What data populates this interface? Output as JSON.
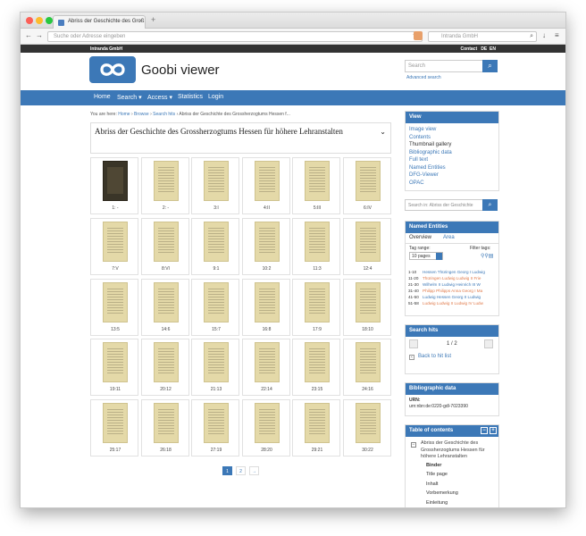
{
  "browser": {
    "tab_title": "Abriss der Geschichte des Groß",
    "tab_close": "×",
    "new_tab": "+",
    "address_placeholder": "Suche oder Adresse eingeben",
    "search_placeholder": "Intranda GmbH"
  },
  "topstrip": {
    "brand": "Intranda GmbH",
    "contact": "Contact",
    "lang_de": "DE",
    "lang_en": "EN"
  },
  "header": {
    "logo_text": "Goobi viewer",
    "search_placeholder": "Search",
    "advanced_search": "Advanced search"
  },
  "nav": {
    "home": "Home",
    "search": "Search ▾",
    "access": "Access ▾",
    "statistics": "Statistics",
    "login": "Login"
  },
  "breadcrumb": {
    "prefix": "You are here:",
    "home": "Home",
    "browse": "Browse",
    "hits": "Search hits",
    "current": "Abriss der Geschichte des Grossherzogtums Hessen f..."
  },
  "record": {
    "title": "Abriss der Geschichte des Grossherzogtums Hessen für höhere Lehranstalten"
  },
  "thumbnails": [
    "1: -",
    "2: -",
    "3:I",
    "4:II",
    "5:III",
    "6:IV",
    "7:V",
    "8:VI",
    "9:1",
    "10:2",
    "11:3",
    "12:4",
    "13:5",
    "14:6",
    "15:7",
    "16:8",
    "17:9",
    "18:10",
    "19:11",
    "20:12",
    "21:13",
    "22:14",
    "23:15",
    "24:16",
    "25:17",
    "26:18",
    "27:19",
    "28:20",
    "29:21",
    "30:22"
  ],
  "pager": {
    "page1": "1",
    "page2": "2",
    "next": "→"
  },
  "view_panel": {
    "heading": "View",
    "links": [
      "Image view",
      "Contents",
      "Thumbnail gallery",
      "Bibliographic data",
      "Full text",
      "Named Entities",
      "DFG-Viewer",
      "OPAC"
    ],
    "current_index": 2
  },
  "record_search": {
    "placeholder": "Search in: Abriss der Geschichte"
  },
  "named_entities": {
    "heading": "Named Entities",
    "tab_overview": "Overview",
    "tab_area": "Area",
    "tag_range_label": "Tag range:",
    "tag_range_value": "10 pages",
    "filter_label": "Filter tags:",
    "rows": [
      {
        "range": "1-10",
        "text": "Hessen Thüringen Georg I Ludwig"
      },
      {
        "range": "11-20",
        "text": "Thüringen Ludwig Ludwig II Frie"
      },
      {
        "range": "21-30",
        "text": "Wilhelm II Ludwig Heinrich III W"
      },
      {
        "range": "31-40",
        "text": "Philipp Philipps Anna Georg I Ma"
      },
      {
        "range": "41-50",
        "text": "Ludwig Hessen Georg II Ludwig"
      },
      {
        "range": "51-58",
        "text": "Ludwig Ludwig II Ludwig IV Ludw"
      }
    ]
  },
  "search_hits": {
    "heading": "Search hits",
    "counter": "1 / 2",
    "back": "Back to hit list"
  },
  "bib_data": {
    "heading": "Bibliographic data",
    "urn_label": "URN:",
    "urn_value": "urn:nbn:de:0220-gdl-7023390"
  },
  "toc": {
    "heading": "Table of contents",
    "root": "Abriss der Geschichte des Grossherzogtums Hessen für höhere Lehranstalten",
    "items": [
      "Binder",
      "Title page",
      "Inhalt",
      "Vorbemerkung",
      "Einleitung"
    ]
  },
  "colors": {
    "accent": "#3c78b7",
    "topstrip": "#333333"
  }
}
